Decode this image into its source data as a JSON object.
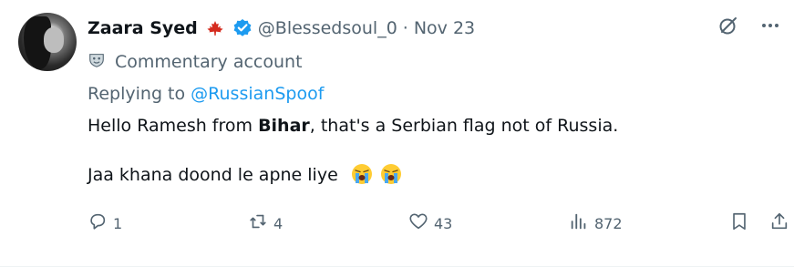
{
  "author": {
    "name": "Zaara Syed",
    "handle": "@Blessedsoul_0",
    "separator": "·",
    "date": "Nov 23"
  },
  "label": {
    "text": "Commentary account"
  },
  "reply": {
    "prefix": "Replying to",
    "mention": "@RussianSpoof"
  },
  "body": {
    "line1_pre": "Hello Ramesh from ",
    "line1_bold": "Bihar",
    "line1_post": ", that's a Serbian flag not of Russia.",
    "line2": "Jaa khana doond le apne liye"
  },
  "actions": {
    "replies": "1",
    "reposts": "4",
    "likes": "43",
    "views": "872"
  },
  "colors": {
    "accent": "#1d9bf0",
    "muted": "#536471",
    "text": "#0f1419",
    "flag_red": "#d52b1e",
    "verified": "#1d9bf0"
  },
  "icons": [
    "canada-flag-icon",
    "verified-badge-icon",
    "grok-icon",
    "more-icon",
    "commentary-icon",
    "loudly-crying-face-emoji",
    "reply-icon",
    "repost-icon",
    "like-icon",
    "views-icon",
    "bookmark-icon",
    "share-icon"
  ]
}
